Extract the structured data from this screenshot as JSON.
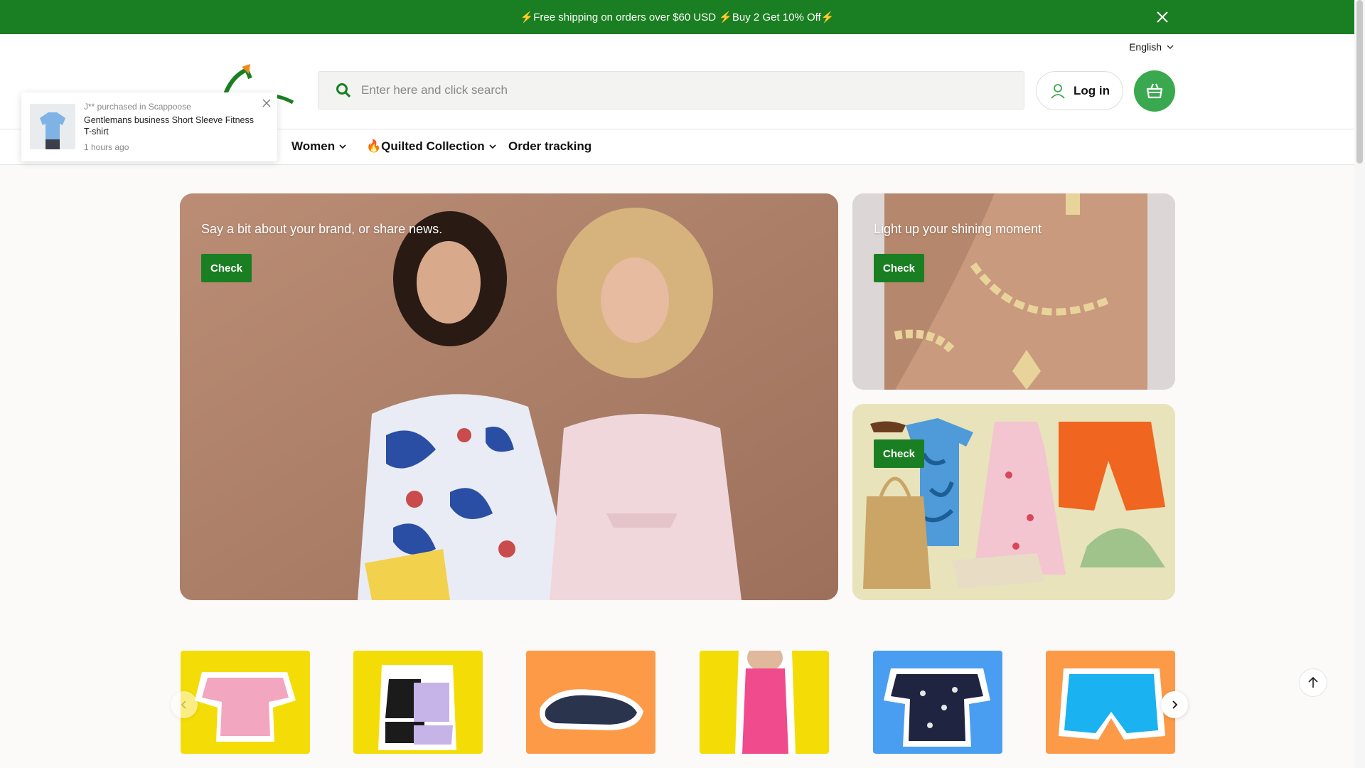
{
  "announcement": {
    "text": "⚡Free shipping on orders over $60 USD ⚡Buy 2 Get 10% Off⚡",
    "close_icon": "close-icon"
  },
  "header": {
    "language": "English",
    "search_placeholder": "Enter here and click search",
    "login_label": "Log in",
    "cart_icon": "basket-icon",
    "brand_color": "#1a7f22",
    "cart_color": "#3aa84e"
  },
  "nav": {
    "items": [
      {
        "label": "Women",
        "has_dropdown": true
      },
      {
        "label": "🔥Quilted Collection",
        "has_dropdown": true
      },
      {
        "label": "Order tracking",
        "has_dropdown": false
      }
    ]
  },
  "popup": {
    "meta": "J** purchased in Scappoose",
    "product": "Gentlemans business Short Sleeve Fitness T-shirt",
    "time": "1 hours ago"
  },
  "hero": {
    "main": {
      "text": "Say a bit about your brand, or share news.",
      "button": "Check"
    },
    "top": {
      "text": "Light up your shining moment",
      "button": "Check"
    },
    "bottom": {
      "text": "",
      "button": "Check"
    }
  },
  "categories": [
    {
      "icon": "pink-gingham-top",
      "bg": "#f4dc06"
    },
    {
      "icon": "tank-set",
      "bg": "#f4dc06"
    },
    {
      "icon": "clog-shoe",
      "bg": "#fc9a48"
    },
    {
      "icon": "pink-dress",
      "bg": "#f4dc06"
    },
    {
      "icon": "floral-blouse",
      "bg": "#4a9ef1"
    },
    {
      "icon": "blue-shorts",
      "bg": "#fc9a48"
    }
  ]
}
